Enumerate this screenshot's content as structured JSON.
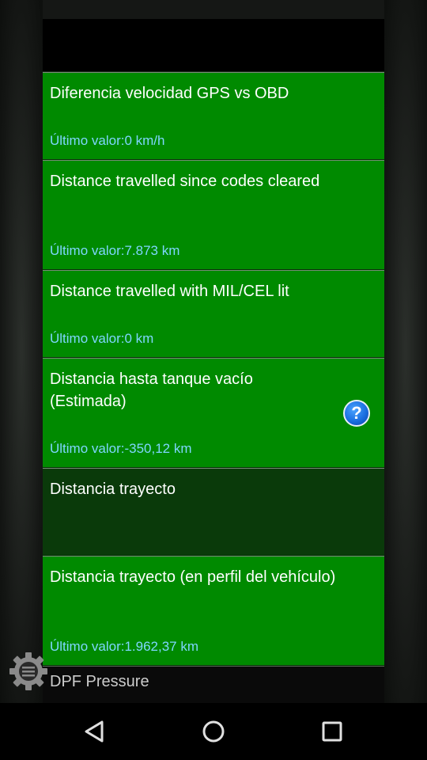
{
  "items": [
    {
      "title": "Diferencia velocidad GPS vs OBD",
      "value": "Último valor:0 km/h"
    },
    {
      "title": "Distance travelled since codes cleared",
      "value": "Último valor:7.873 km"
    },
    {
      "title": "Distance travelled with MIL/CEL lit",
      "value": "Último valor:0 km"
    },
    {
      "title": "Distancia hasta tanque vacío (Estimada)",
      "value": "Último valor:-350,12 km",
      "help": "?"
    },
    {
      "title": "Distancia trayecto",
      "value": ""
    },
    {
      "title": "Distancia trayecto (en perfil del vehículo)",
      "value": "Último valor:1.962,37 km"
    },
    {
      "title": "DPF Pressure"
    }
  ],
  "colors": {
    "item_bg": "#008a00",
    "item_bg_dim": "#0a3a0a",
    "value_text": "#7fd6ff",
    "title_text": "#ffffff"
  },
  "icons": {
    "help": "question-circle-icon",
    "menu": "gear-menu-icon",
    "nav_back": "triangle-back-icon",
    "nav_home": "circle-home-icon",
    "nav_recents": "square-recents-icon"
  }
}
